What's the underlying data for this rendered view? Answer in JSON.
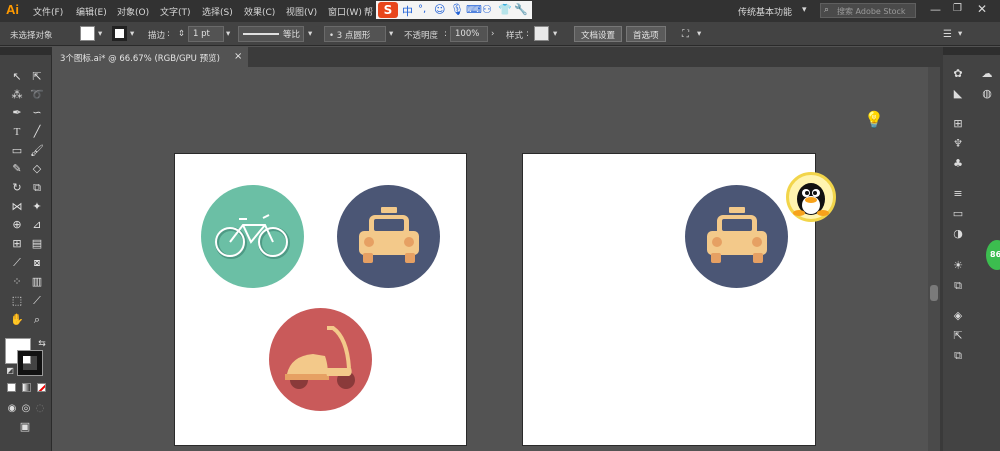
{
  "menubar": {
    "app_logo": "Ai",
    "items": [
      "文件(F)",
      "编辑(E)",
      "对象(O)",
      "文字(T)",
      "选择(S)",
      "效果(C)",
      "视图(V)",
      "窗口(W)",
      "帮"
    ],
    "workspace": "传统基本功能",
    "search_placeholder": "搜索 Adobe Stock"
  },
  "ime": {
    "logo": "S",
    "mode": "中"
  },
  "options": {
    "selection_status": "未选择对象",
    "stroke_label": "描边",
    "stroke_value": "1 pt",
    "stroke_profile": "等比",
    "brush_label": "3 点圆形",
    "opacity_label": "不透明度",
    "opacity_value": "100%",
    "style_label": "样式",
    "doc_setup_button": "文档设置",
    "prefs_button": "首选项"
  },
  "document_tab": {
    "title": "3个图标.ai* @ 66.67% (RGB/GPU 预览)",
    "close": "×"
  },
  "floating": {
    "badge": "86"
  },
  "colors": {
    "teal": "#6bbfa5",
    "navy": "#4b5675",
    "red": "#c95a5a",
    "taxi": "#f3c98a",
    "accent": "#ff9a00"
  }
}
